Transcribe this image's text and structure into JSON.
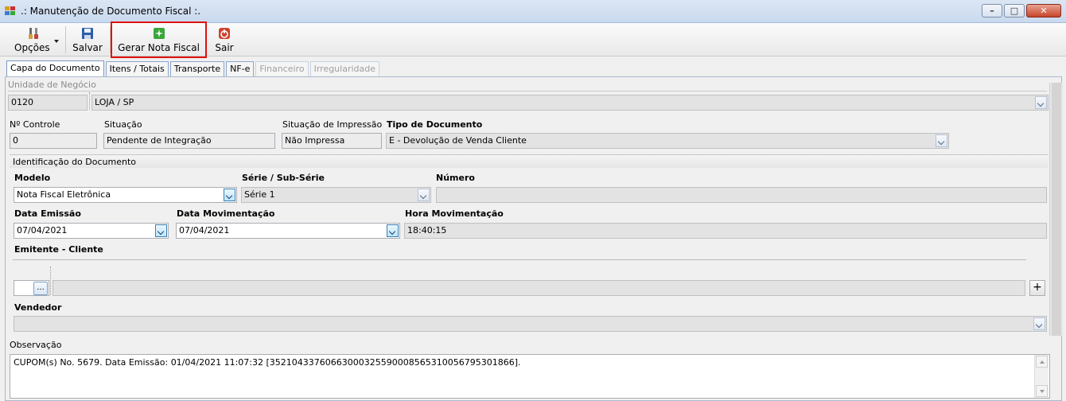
{
  "window": {
    "title": ".: Manutenção de Documento Fiscal :.",
    "minimize_glyph": "–",
    "maximize_glyph": "□",
    "close_glyph": "✕"
  },
  "toolbar": {
    "options_label": "Opções",
    "save_label": "Salvar",
    "generate_invoice_label": "Gerar Nota Fiscal",
    "exit_label": "Sair"
  },
  "tabs": [
    {
      "label": "Capa do Documento",
      "state": "active"
    },
    {
      "label": "Itens / Totais",
      "state": "normal"
    },
    {
      "label": "Transporte",
      "state": "normal"
    },
    {
      "label": "NF-e",
      "state": "normal"
    },
    {
      "label": "Financeiro",
      "state": "disabled"
    },
    {
      "label": "Irregularidade",
      "state": "disabled"
    }
  ],
  "business_unit": {
    "label": "Unidade de Negócio",
    "code": "0120",
    "name": "LOJA                         / SP"
  },
  "header_fields": {
    "control_no_label": "Nº Controle",
    "control_no": "0",
    "status_label": "Situação",
    "status": "Pendente de Integração",
    "print_status_label": "Situação de Impressão",
    "print_status": "Não Impressa",
    "doc_type_label": "Tipo de Documento",
    "doc_type": "E - Devolução de Venda Cliente"
  },
  "document_id": {
    "section_label": "Identificação do Documento",
    "model_label": "Modelo",
    "model": "Nota Fiscal Eletrônica",
    "series_label": "Série / Sub-Série",
    "series": "Série 1",
    "number_label": "Número",
    "number": "",
    "issue_date_label": "Data Emissão",
    "issue_date": "07/04/2021",
    "movement_date_label": "Data Movimentação",
    "movement_date": "07/04/2021",
    "movement_time_label": "Hora Movimentação",
    "movement_time": "18:40:15"
  },
  "issuer": {
    "label": "Emitente - Cliente",
    "lookup_glyph": "...",
    "value": "",
    "add_glyph": "+"
  },
  "seller": {
    "label": "Vendedor",
    "value": ""
  },
  "notes": {
    "label": "Observação",
    "text": "CUPOM(s) No. 5679.  Data Emissão: 01/04/2021 11:07:32 [35210433760663000325590008565310056795301866]."
  },
  "colors": {
    "highlight_border": "#e01010",
    "titlebar": "#c9d9ee"
  }
}
